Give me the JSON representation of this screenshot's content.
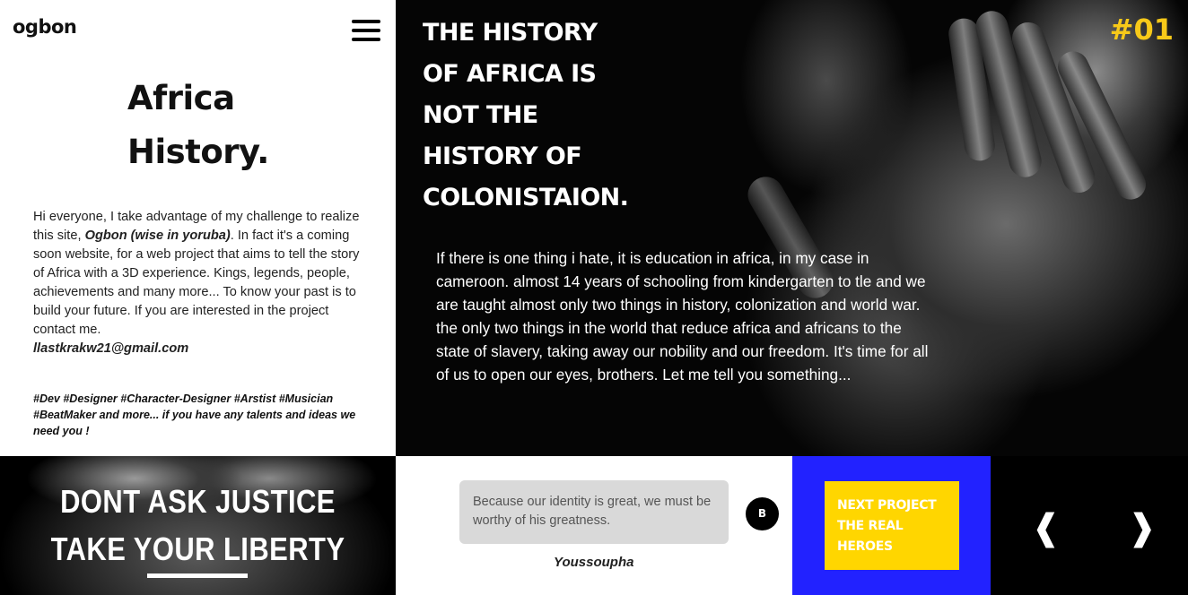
{
  "brand": {
    "logo": "ogbon"
  },
  "menu": {
    "icon": "hamburger-menu-icon"
  },
  "intro": {
    "title_line1": "Africa",
    "title_line2": "History.",
    "text_part1": "Hi everyone, I take advantage of my challenge to realize this site, ",
    "text_bold": "Ogbon (wise in yoruba)",
    "text_part2": ". In fact it's a coming soon website, for a web project that aims to tell the story of Africa with a 3D experience. Kings, legends, people, achievements and many more... To know your past is to build your future. If you are interested in the project contact me.",
    "email": "llastkrakw21@gmail.com",
    "tags": "#Dev #Designer #Character-Designer #Arstist #Musician #BeatMaker and more... if you have any talents and ideas we need you !"
  },
  "hero": {
    "heading_lines": [
      "THE HISTORY",
      "OF AFRICA IS",
      "NOT THE",
      "HISTORY OF",
      "COLONISTAION."
    ],
    "number": "#01",
    "text": "If there is one thing i hate, it is education in africa, in my case in cameroon. almost 14 years of schooling from kindergarten to tle and we are taught almost only two things in history, colonization and world war. the only two things in the world that reduce africa and africans to the state of slavery, taking away our nobility and our freedom. It's time for all of us to open our eyes, brothers. Let me tell you something..."
  },
  "slogan": {
    "line1": "DONT ASK JUSTICE",
    "line2": "TAKE YOUR LIBERTY"
  },
  "quote": {
    "text": "Because our identity is great, we must be worthy of his greatness.",
    "author": "Youssoupha",
    "badge": "B"
  },
  "next_project": {
    "line1": "NEXT PROJECT",
    "line2": "THE REAL",
    "line3": "HEROES"
  },
  "nav": {
    "prev": "❰",
    "next": "❱"
  },
  "colors": {
    "accent_yellow": "#ffd600",
    "accent_blue": "#2222ff",
    "number_yellow": "#f7c919"
  }
}
